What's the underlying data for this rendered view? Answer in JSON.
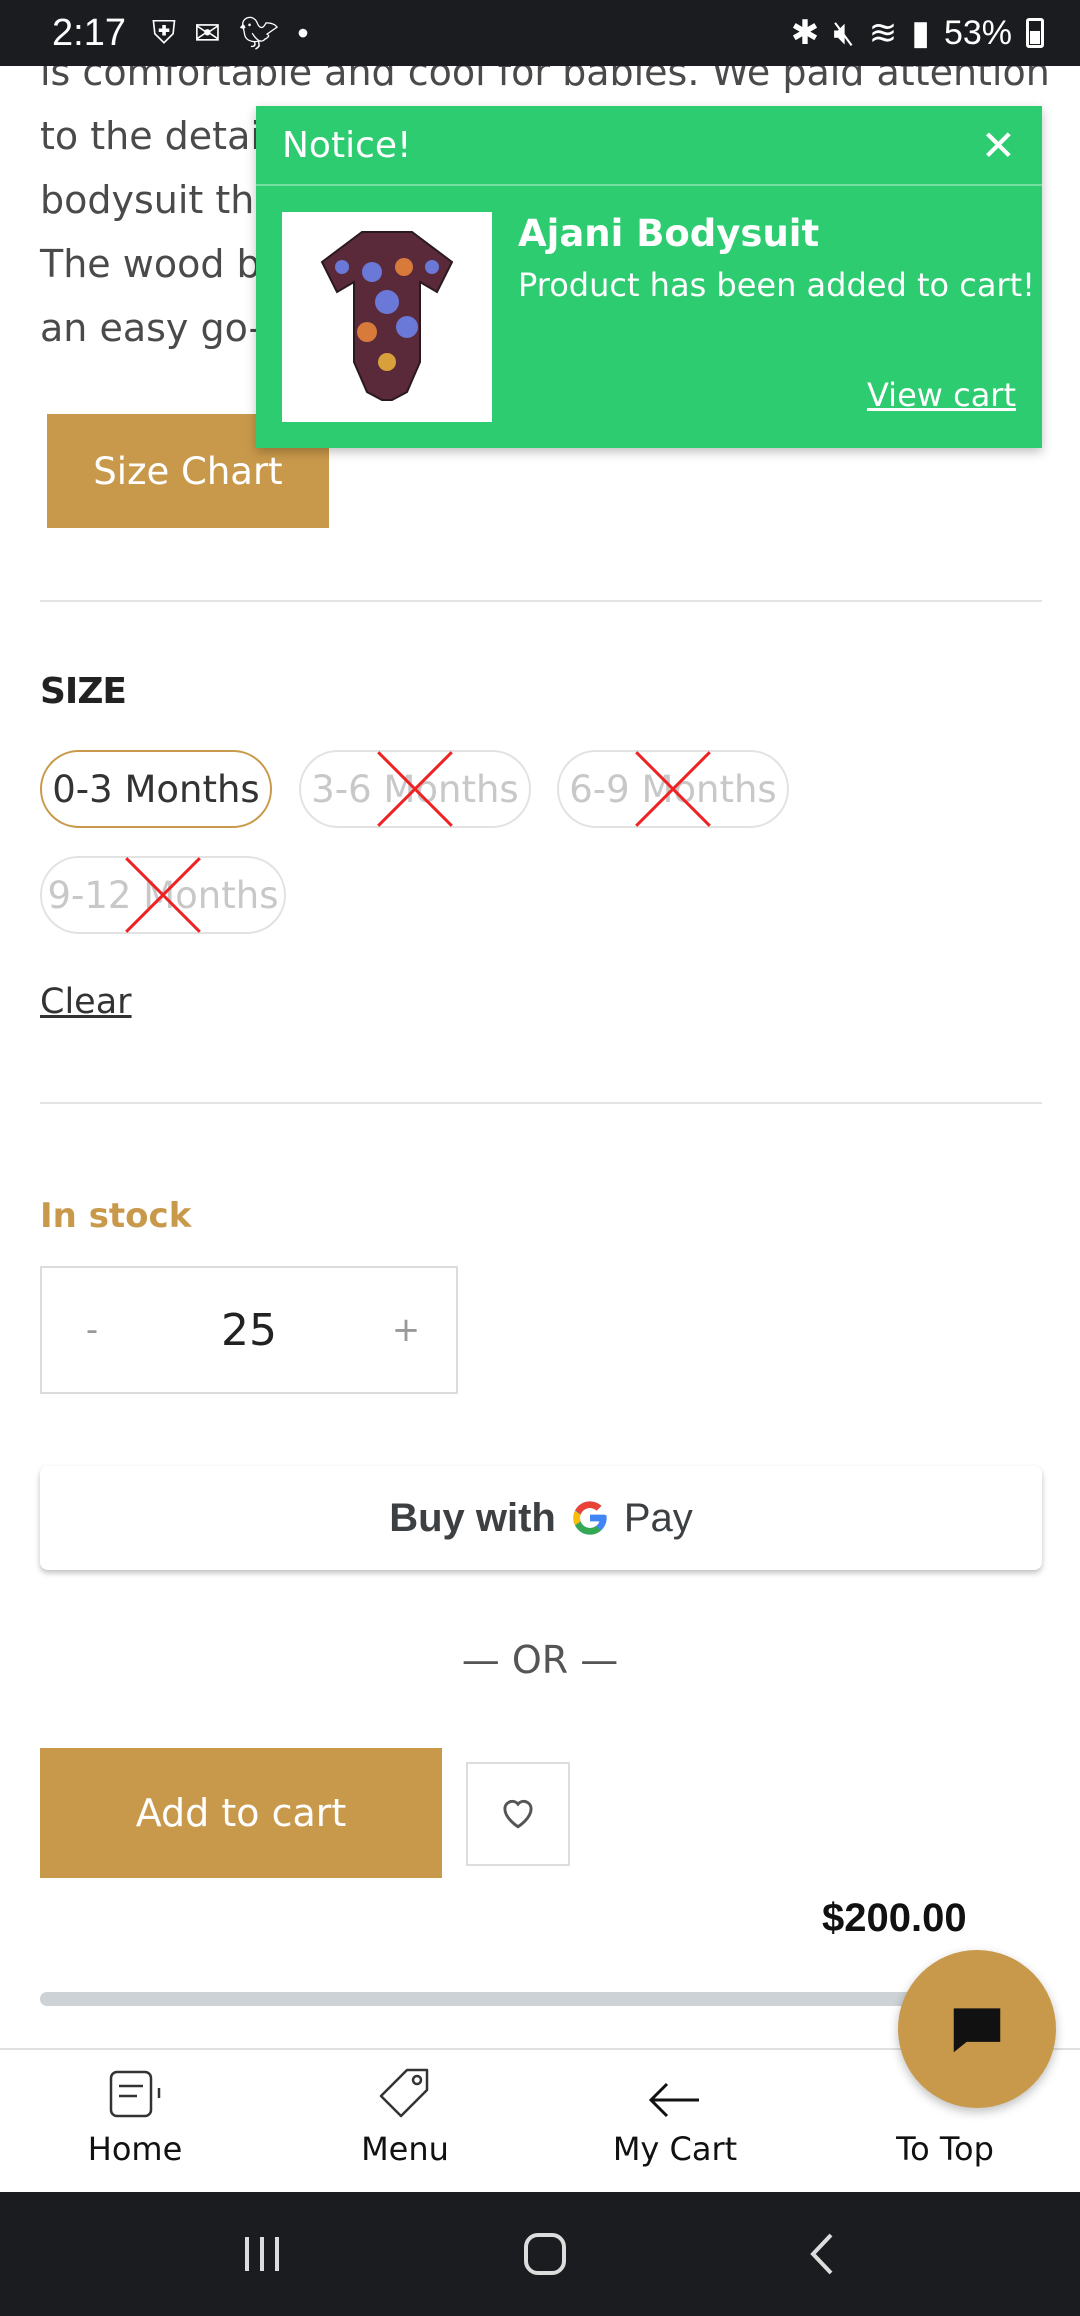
{
  "status_bar": {
    "time": "2:17",
    "battery": "53%"
  },
  "description": {
    "lines": [
      "is comfortable and cool for babies. We paid attention",
      "to the details and used the finest materials for this",
      "bodysuit that also features wooden buttons.",
      "The wood buttons make this",
      "an easy go-to piece."
    ]
  },
  "size_chart_label": "Size Chart",
  "size": {
    "label": "SIZE",
    "options": [
      {
        "label": "0-3 Months",
        "available": true,
        "selected": true
      },
      {
        "label": "3-6 Months",
        "available": false,
        "selected": false
      },
      {
        "label": "6-9 Months",
        "available": false,
        "selected": false
      },
      {
        "label": "9-12 Months",
        "available": false,
        "selected": false
      }
    ],
    "clear_label": "Clear"
  },
  "stock_status": "In stock",
  "quantity": {
    "minus": "-",
    "value": "25",
    "plus": "+"
  },
  "gpay": {
    "buy_with": "Buy with",
    "g": "G",
    "pay": "Pay"
  },
  "or_label": "— OR —",
  "add_to_cart_label": "Add to cart",
  "price": "$200.00",
  "bottom_nav": {
    "home": "Home",
    "menu": "Menu",
    "cart": "My Cart",
    "top": "To Top"
  },
  "toast": {
    "header": "Notice!",
    "close": "✕",
    "product_name": "Ajani Bodysuit",
    "message": "Product has been added to cart!",
    "link": "View cart"
  },
  "colors": {
    "accent": "#c9994b",
    "toast_green": "#2ecc71",
    "unavailable_cross": "#ee2222"
  },
  "icons": {
    "home": "home-icon",
    "menu": "tag-icon",
    "cart": "arrow-left-icon",
    "chat": "chat-icon",
    "wishlist": "heart-icon"
  }
}
